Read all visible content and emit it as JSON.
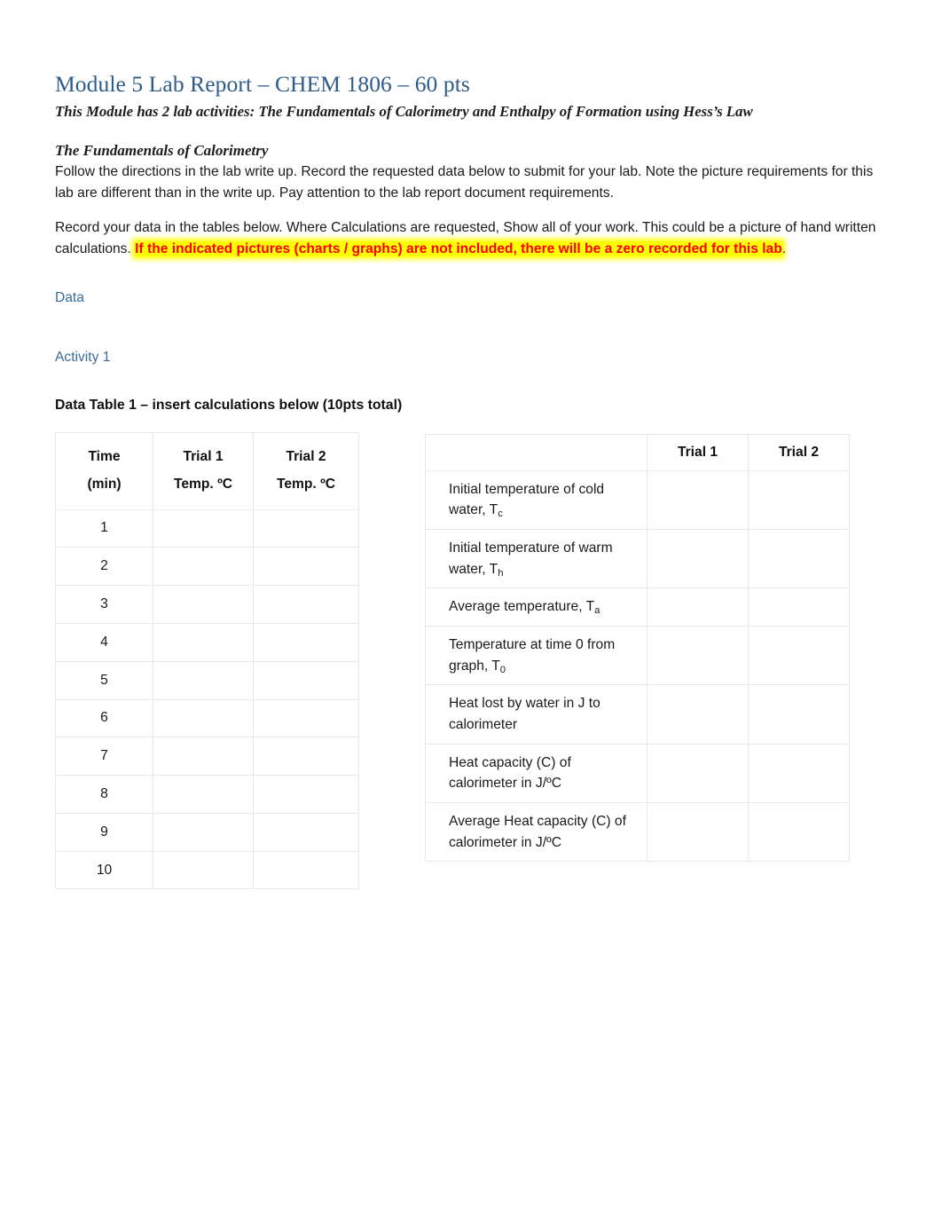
{
  "document": {
    "title": "Module 5 Lab Report – CHEM 1806 – 60 pts",
    "subtitle": "This Module has 2 lab activities: The Fundamentals of Calorimetry and Enthalpy of Formation using Hess’s Law",
    "section_heading": "The Fundamentals of Calorimetry",
    "paragraph_1": "Follow the directions in the lab write up. Record the requested data below to submit for your lab. Note the picture requirements for this lab are different than in the write up. Pay attention to the lab report document requirements.",
    "paragraph_2_plain": "Record your data in the tables below. Where Calculations are requested, Show all of your work. This could be a picture of hand written calculations. ",
    "paragraph_2_highlighted": "If the indicated pictures (charts / graphs) are not included, there will be a zero recorded for this lab",
    "paragraph_2_tail": ".",
    "data_heading": "Data",
    "activity_heading": "Activity 1",
    "table_caption": "Data Table 1 – insert calculations below (10pts total)"
  },
  "colors": {
    "heading_blue": "#2e5c8a",
    "subheading_blue": "#3b6a9c",
    "highlight_background": "#ffff00",
    "highlight_text": "#ff0000",
    "table_border": "#e9e9e9",
    "body_text": "#1a1a1a"
  },
  "time_table": {
    "headers": [
      {
        "line1": "Time",
        "line2": "(min)"
      },
      {
        "line1": "Trial 1",
        "line2": "Temp. ºC"
      },
      {
        "line1": "Trial 2",
        "line2": "Temp. ºC"
      }
    ],
    "rows": [
      {
        "time": "1",
        "trial1": "",
        "trial2": ""
      },
      {
        "time": "2",
        "trial1": "",
        "trial2": ""
      },
      {
        "time": "3",
        "trial1": "",
        "trial2": ""
      },
      {
        "time": "4",
        "trial1": "",
        "trial2": ""
      },
      {
        "time": "5",
        "trial1": "",
        "trial2": ""
      },
      {
        "time": "6",
        "trial1": "",
        "trial2": ""
      },
      {
        "time": "7",
        "trial1": "",
        "trial2": ""
      },
      {
        "time": "8",
        "trial1": "",
        "trial2": ""
      },
      {
        "time": "9",
        "trial1": "",
        "trial2": ""
      },
      {
        "time": "10",
        "trial1": "",
        "trial2": ""
      }
    ]
  },
  "measures_table": {
    "headers": {
      "corner": "",
      "trial1": "Trial 1",
      "trial2": "Trial 2"
    },
    "rows": [
      {
        "label_main": "Initial temperature of cold water, T",
        "label_sub": "c",
        "trial1": "",
        "trial2": ""
      },
      {
        "label_main": "Initial temperature of warm water, T",
        "label_sub": "h",
        "trial1": "",
        "trial2": ""
      },
      {
        "label_main": "Average temperature, T",
        "label_sub": "a",
        "trial1": "",
        "trial2": ""
      },
      {
        "label_main": "Temperature at time 0 from graph, T",
        "label_sub": "0",
        "trial1": "",
        "trial2": ""
      },
      {
        "label_main": "Heat lost by water in J to calorimeter",
        "label_sub": "",
        "trial1": "",
        "trial2": ""
      },
      {
        "label_main": "Heat capacity (C) of calorimeter in J/ºC",
        "label_sub": "",
        "trial1": "",
        "trial2": ""
      },
      {
        "label_main": "Average Heat capacity (C) of calorimeter in J/ºC",
        "label_sub": "",
        "trial1": "",
        "trial2": ""
      }
    ]
  }
}
